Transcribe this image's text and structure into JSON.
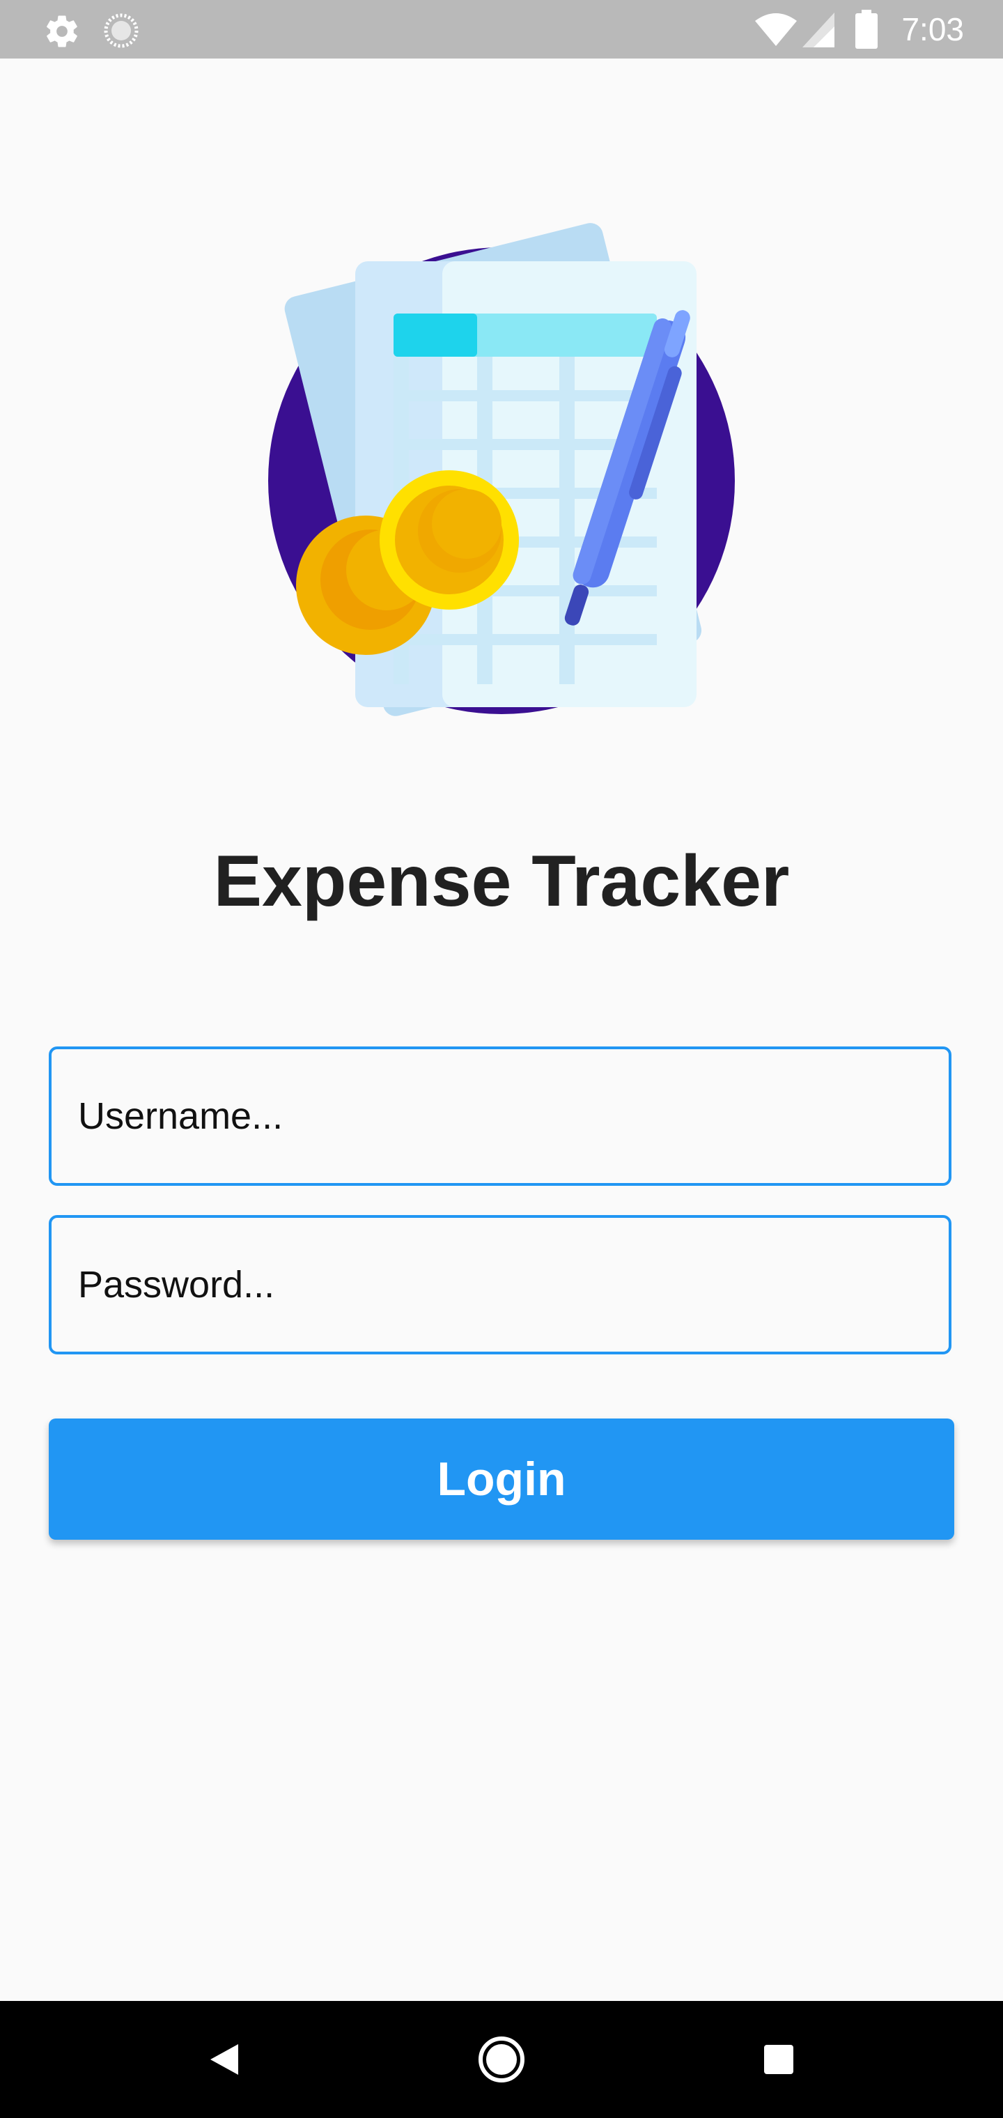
{
  "status_bar": {
    "time": "7:03",
    "icons": [
      "settings-icon",
      "loading-icon",
      "wifi-icon",
      "signal-icon",
      "battery-icon"
    ]
  },
  "app": {
    "title": "Expense Tracker"
  },
  "form": {
    "username_placeholder": "Username...",
    "password_placeholder": "Password...",
    "login_label": "Login"
  },
  "navigation": {
    "buttons": [
      "back-icon",
      "home-icon",
      "recents-icon"
    ]
  },
  "colors": {
    "accent": "#2196f3",
    "title": "#212121",
    "background": "#fafafa",
    "status_bar": "#b9b9b9",
    "nav_bar": "#000000"
  }
}
